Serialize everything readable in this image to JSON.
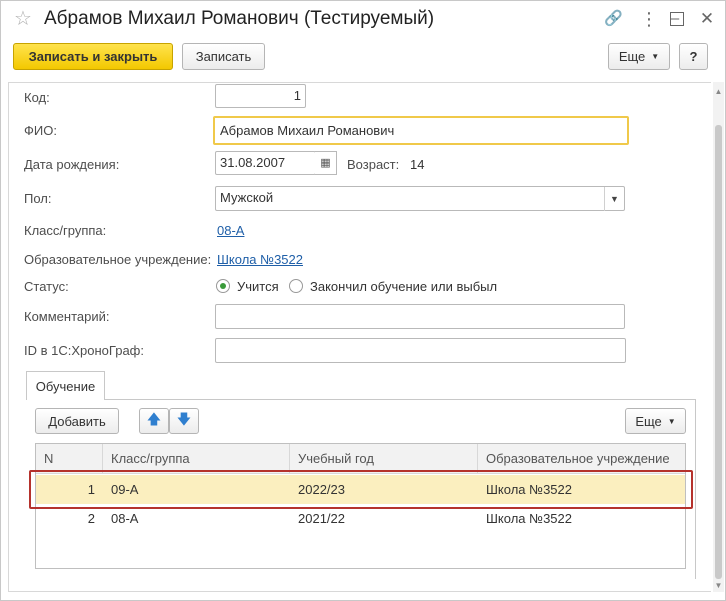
{
  "window": {
    "title": "Абрамов Михаил Романович (Тестируемый)",
    "icons": [
      "star-icon",
      "link-icon",
      "more-vertical-icon",
      "minimize-icon",
      "maximize-icon",
      "close-icon"
    ]
  },
  "toolbar": {
    "save_close_label": "Записать и закрыть",
    "save_label": "Записать",
    "more_label": "Еще",
    "help_label": "?"
  },
  "form": {
    "code_label": "Код:",
    "code_value": "1",
    "fio_label": "ФИО:",
    "fio_value": "Абрамов Михаил Романович",
    "dob_label": "Дата рождения:",
    "dob_value": "31.08.2007",
    "age_label": "Возраст:",
    "age_value": "14",
    "gender_label": "Пол:",
    "gender_value": "Мужской",
    "class_label": "Класс/группа:",
    "class_value": "08-А",
    "school_label": "Образовательное учреждение:",
    "school_value": "Школа №3522",
    "status_label": "Статус:",
    "status_options": [
      {
        "label": "Учится",
        "selected": true
      },
      {
        "label": "Закончил обучение или выбыл",
        "selected": false
      }
    ],
    "comment_label": "Комментарий:",
    "comment_value": "",
    "id_label": "ID в 1С:ХроноГраф:",
    "id_value": ""
  },
  "tabs": [
    {
      "label": "Обучение",
      "active": true
    }
  ],
  "table_toolbar": {
    "add_label": "Добавить",
    "more_label": "Еще"
  },
  "table": {
    "columns": [
      "N",
      "Класс/группа",
      "Учебный год",
      "Образовательное учреждение"
    ],
    "rows": [
      {
        "n": "1",
        "class": "09-А",
        "year": "2022/23",
        "school": "Школа №3522",
        "selected": true
      },
      {
        "n": "2",
        "class": "08-А",
        "year": "2021/22",
        "school": "Школа №3522",
        "selected": false
      }
    ]
  },
  "colors": {
    "primary_button": "#f3c800",
    "link": "#1f5fa8",
    "selected_row": "#fbefbf",
    "highlight_border": "#b5322c",
    "focus_border": "#f0c94a"
  }
}
